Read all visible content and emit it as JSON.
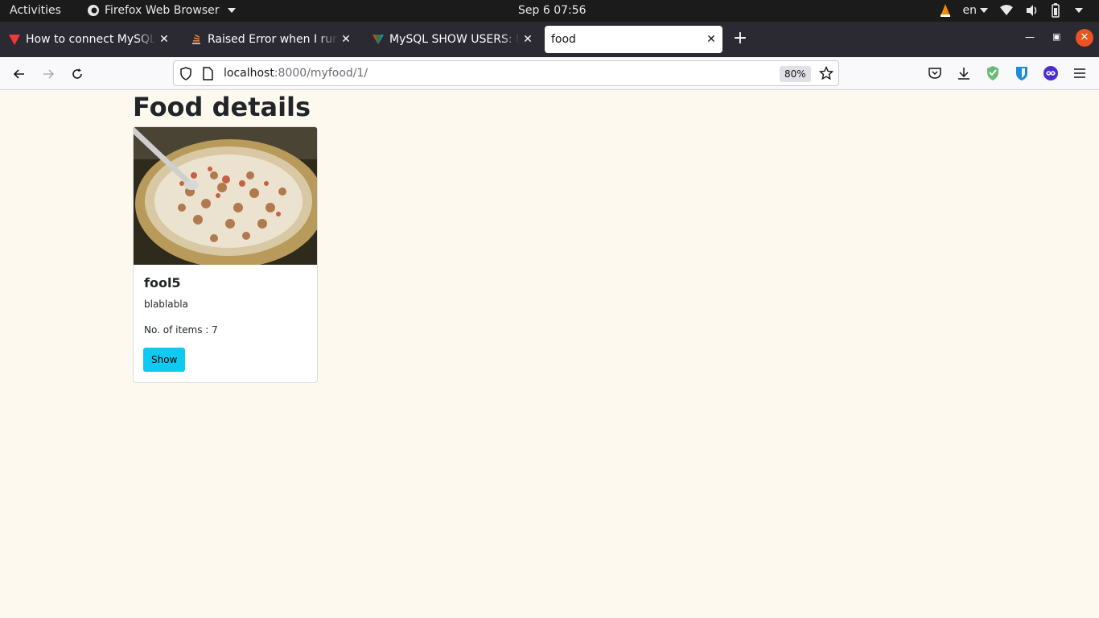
{
  "topbar": {
    "activities": "Activities",
    "app_name": "Firefox Web Browser",
    "clock": "Sep 6  07:56",
    "language": "en"
  },
  "tabs": [
    {
      "label": "How to connect MySQL to",
      "icon": "vivaldi-icon",
      "icon_color": "#ef3939"
    },
    {
      "label": "Raised Error when I run p",
      "icon": "stackoverflow-icon",
      "icon_color": "#f48024"
    },
    {
      "label": "MySQL SHOW USERS: List",
      "icon": "mysqltutorial-icon",
      "icon_color": "#2e7d32"
    },
    {
      "label": "food",
      "icon": "",
      "active": true
    }
  ],
  "navbar": {
    "url_host": "localhost",
    "url_rest": ":8000/myfood/1/",
    "zoom": "80%"
  },
  "page": {
    "heading": "Food details",
    "card": {
      "title": "fool5",
      "description": "blablabla",
      "items": "No. of items : 7",
      "button": "Show"
    }
  },
  "colors": {
    "page_bg": "#fef9ee",
    "button_bg": "#0dcaf0",
    "close_button": "#e95420"
  }
}
